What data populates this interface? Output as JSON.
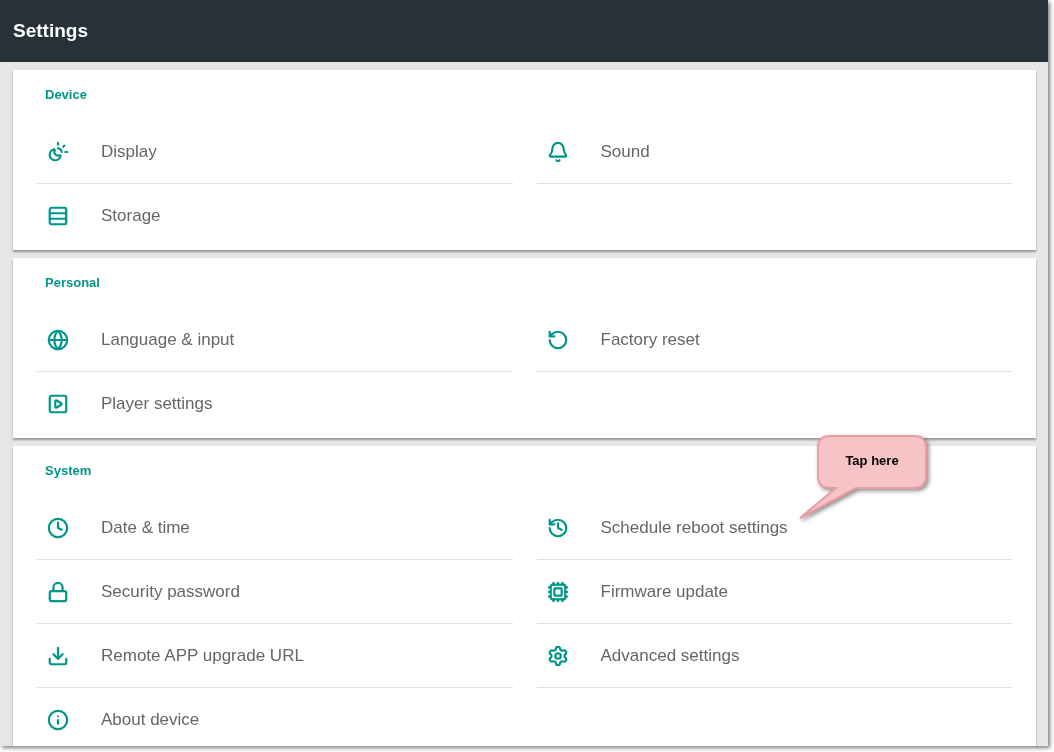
{
  "app_bar": {
    "title": "Settings"
  },
  "sections": [
    {
      "title": "Device",
      "items": [
        {
          "label": "Display"
        },
        {
          "label": "Sound"
        },
        {
          "label": "Storage"
        }
      ]
    },
    {
      "title": "Personal",
      "items": [
        {
          "label": "Language & input"
        },
        {
          "label": "Factory reset"
        },
        {
          "label": "Player settings"
        }
      ]
    },
    {
      "title": "System",
      "items": [
        {
          "label": "Date & time"
        },
        {
          "label": "Schedule reboot settings"
        },
        {
          "label": "Security password"
        },
        {
          "label": "Firmware update"
        },
        {
          "label": "Remote APP upgrade URL"
        },
        {
          "label": "Advanced settings"
        },
        {
          "label": "About device"
        }
      ]
    }
  ],
  "callout": {
    "text": "Tap here"
  }
}
